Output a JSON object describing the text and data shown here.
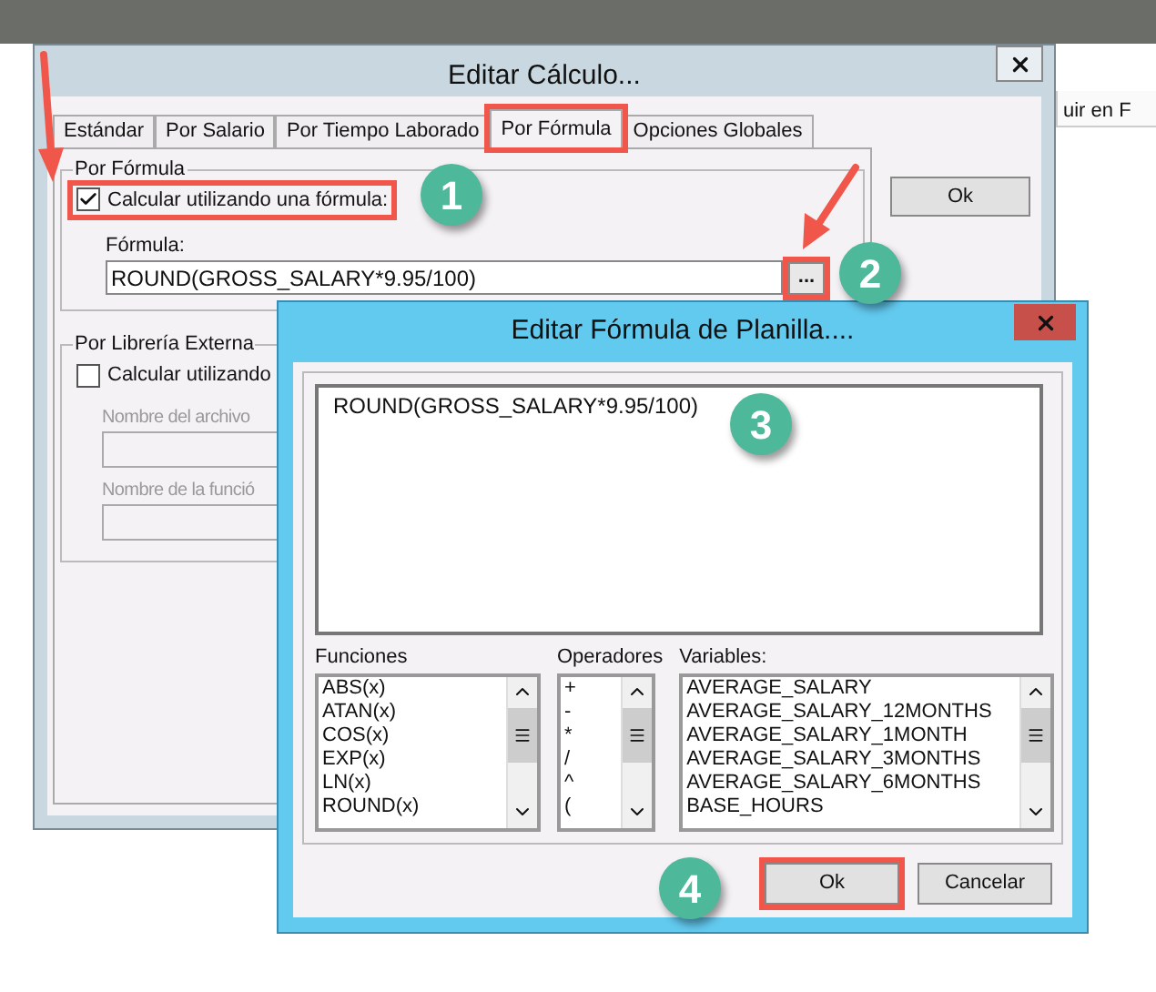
{
  "background_app": {
    "column_header": "uir en F"
  },
  "main_window": {
    "title": "Editar Cálculo...",
    "tabs": [
      {
        "label": "Estándar",
        "selected": false,
        "highlighted": false
      },
      {
        "label": "Por Salario",
        "selected": false,
        "highlighted": false
      },
      {
        "label": "Por Tiempo Laborado",
        "selected": false,
        "highlighted": false
      },
      {
        "label": "Por Fórmula",
        "selected": true,
        "highlighted": true
      },
      {
        "label": "Opciones Globales",
        "selected": false,
        "highlighted": false
      }
    ],
    "formula_group": {
      "title": "Por Fórmula",
      "checkbox": {
        "label": "Calcular utilizando una fórmula:",
        "checked": true,
        "highlighted": true
      },
      "field_label": "Fórmula:",
      "value": "ROUND(GROSS_SALARY*9.95/100)",
      "browse_button": {
        "label": "...",
        "highlighted": true
      }
    },
    "library_group": {
      "title": "Por Librería Externa",
      "checkbox": {
        "label": "Calcular utilizando",
        "checked": false,
        "highlighted": false
      },
      "fields": [
        {
          "label": "Nombre del archivo"
        },
        {
          "label": "Nombre de la funció"
        }
      ]
    },
    "ok_button": "Ok"
  },
  "formula_dialog": {
    "title": "Editar Fórmula de Planilla....",
    "formula": "ROUND(GROSS_SALARY*9.95/100)",
    "lists": [
      {
        "label": "Funciones",
        "items": [
          "ABS(x)",
          "ATAN(x)",
          "COS(x)",
          "EXP(x)",
          "LN(x)",
          "ROUND(x)"
        ]
      },
      {
        "label": "Operadores",
        "items": [
          "+",
          "-",
          "*",
          "/",
          "^",
          "("
        ]
      },
      {
        "label": "Variables:",
        "items": [
          "AVERAGE_SALARY",
          "AVERAGE_SALARY_12MONTHS",
          "AVERAGE_SALARY_1MONTH",
          "AVERAGE_SALARY_3MONTHS",
          "AVERAGE_SALARY_6MONTHS",
          "BASE_HOURS"
        ]
      }
    ],
    "buttons": [
      {
        "label": "Ok",
        "highlighted": true
      },
      {
        "label": "Cancelar",
        "highlighted": false
      }
    ]
  },
  "callouts": [
    "1",
    "2",
    "3",
    "4"
  ]
}
